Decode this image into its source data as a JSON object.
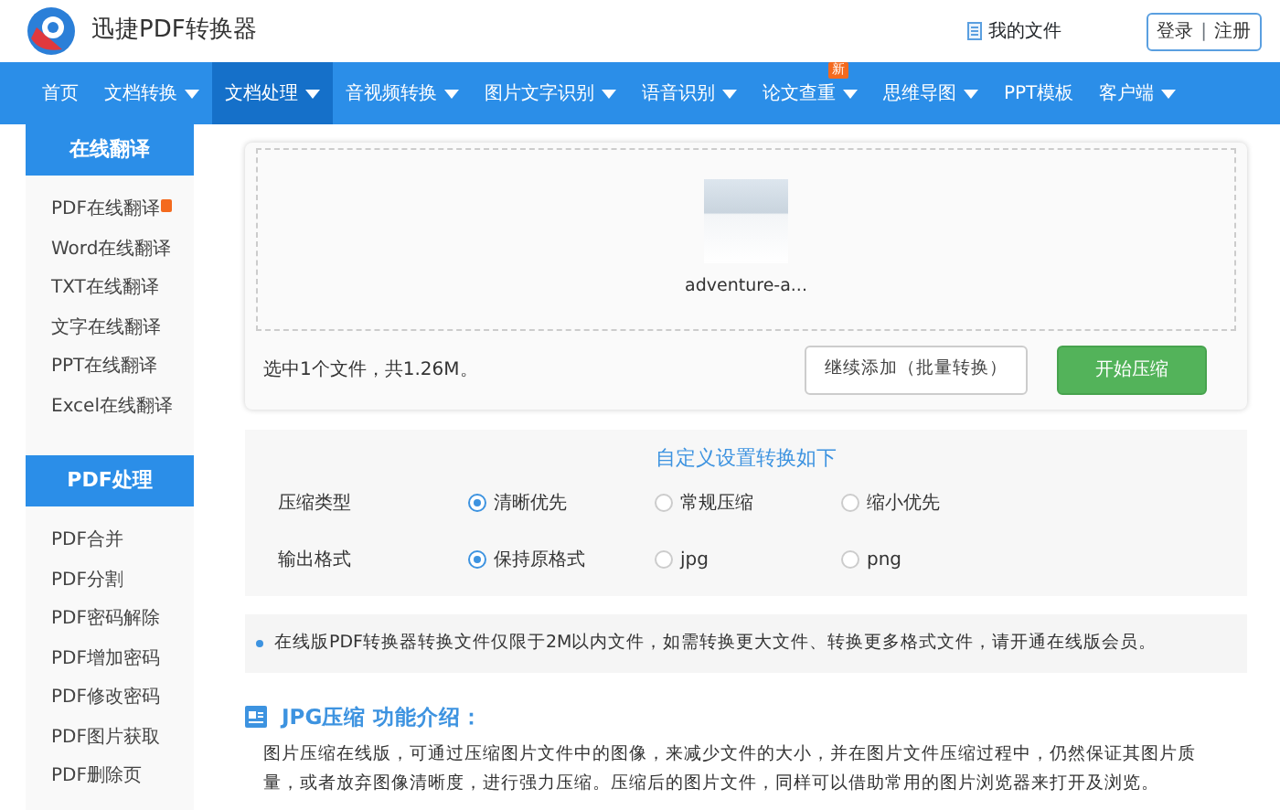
{
  "header": {
    "logo_text": "迅捷PDF转换器",
    "my_files": "我的文件",
    "login": "登录",
    "separator": "|",
    "register": "注册"
  },
  "nav": [
    {
      "label": "首页",
      "dropdown": false,
      "selected": false
    },
    {
      "label": "文档转换",
      "dropdown": true,
      "selected": false
    },
    {
      "label": "文档处理",
      "dropdown": true,
      "selected": true
    },
    {
      "label": "音视频转换",
      "dropdown": true,
      "selected": false
    },
    {
      "label": "图片文字识别",
      "dropdown": true,
      "selected": false
    },
    {
      "label": "语音识别",
      "dropdown": true,
      "selected": false
    },
    {
      "label": "论文查重",
      "dropdown": true,
      "selected": false,
      "badge": "新"
    },
    {
      "label": "思维导图",
      "dropdown": true,
      "selected": false
    },
    {
      "label": "PPT模板",
      "dropdown": false,
      "selected": false
    },
    {
      "label": "客户端",
      "dropdown": true,
      "selected": false
    }
  ],
  "sidebar": [
    {
      "title": "在线翻译",
      "items": [
        {
          "label": "PDF在线翻译",
          "hot": true
        },
        {
          "label": "Word在线翻译",
          "hot": false
        },
        {
          "label": "TXT在线翻译",
          "hot": false
        },
        {
          "label": "文字在线翻译",
          "hot": false
        },
        {
          "label": "PPT在线翻译",
          "hot": false
        },
        {
          "label": "Excel在线翻译",
          "hot": false
        }
      ]
    },
    {
      "title": "PDF处理",
      "items": [
        {
          "label": "PDF合并",
          "hot": false
        },
        {
          "label": "PDF分割",
          "hot": false
        },
        {
          "label": "PDF密码解除",
          "hot": false
        },
        {
          "label": "PDF增加密码",
          "hot": false
        },
        {
          "label": "PDF修改密码",
          "hot": false
        },
        {
          "label": "PDF图片获取",
          "hot": false
        },
        {
          "label": "PDF删除页",
          "hot": false
        }
      ]
    }
  ],
  "upload": {
    "file_name": "adventure-a...",
    "summary": "选中1个文件，共1.26M。",
    "add_button": "继续添加（批量转换）",
    "start_button": "开始压缩"
  },
  "settings": {
    "title": "自定义设置转换如下",
    "rows": [
      {
        "label": "压缩类型",
        "options": [
          {
            "label": "清晰优先",
            "selected": true
          },
          {
            "label": "常规压缩",
            "selected": false
          },
          {
            "label": "缩小优先",
            "selected": false
          }
        ]
      },
      {
        "label": "输出格式",
        "options": [
          {
            "label": "保持原格式",
            "selected": true
          },
          {
            "label": "jpg",
            "selected": false
          },
          {
            "label": "png",
            "selected": false
          }
        ]
      }
    ]
  },
  "notice": "在线版PDF转换器转换文件仅限于2M以内文件，如需转换更大文件、转换更多格式文件，请开通在线版会员。",
  "intro": {
    "title": "JPG压缩 功能介绍：",
    "text": "图片压缩在线版，可通过压缩图片文件中的图像，来减少文件的大小，并在图片文件压缩过程中，仍然保证其图片质量，或者放弃图像清晰度，进行强力压缩。压缩后的图片文件，同样可以借助常用的图片浏览器来打开及浏览。"
  }
}
